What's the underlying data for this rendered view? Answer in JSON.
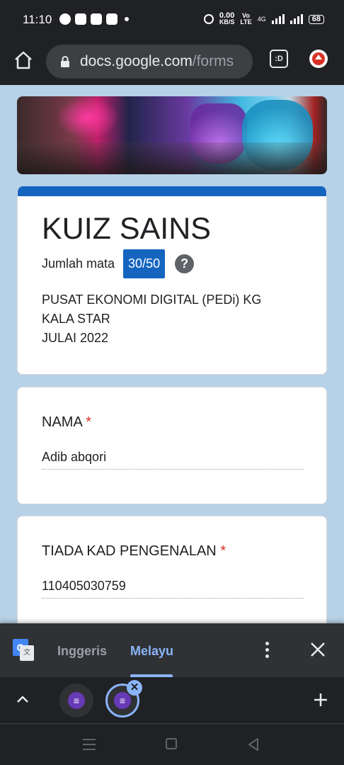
{
  "status_bar": {
    "time": "11:10",
    "net_speed_value": "0.00",
    "net_speed_unit": "KB/S",
    "volte_top": "Vo",
    "volte_bottom": "LTE",
    "network": "4G",
    "battery": "68"
  },
  "browser": {
    "url_host": "docs.google.com",
    "url_path": "/forms",
    "tab_switcher_label": ":D"
  },
  "form": {
    "title": "KUIZ SAINS",
    "score_label": "Jumlah mata",
    "score_value": "30/50",
    "help_glyph": "?",
    "description_lines": [
      "PUSAT EKONOMI DIGITAL (PEDi) KG",
      "KALA STAR",
      "JULAI 2022"
    ],
    "questions": [
      {
        "label": "NAMA",
        "required_mark": "*",
        "answer": "Adib abqori"
      },
      {
        "label": "TIADA KAD PENGENALAN",
        "required_mark": "*",
        "answer": "110405030759"
      }
    ],
    "accent_color": "#1565c0"
  },
  "translate_bar": {
    "logo_letter": "G",
    "source_language": "Inggeris",
    "target_language": "Melayu",
    "active_color": "#8ab4f8"
  },
  "tab_strip": {
    "close_glyph": "✕"
  },
  "icons": [
    "home-icon",
    "lock-icon",
    "update-icon",
    "google-translate-icon",
    "more-vert-icon",
    "close-icon",
    "chevron-up-icon",
    "forms-tab-icon",
    "plus-icon",
    "recents-icon",
    "home-nav-icon",
    "back-icon"
  ]
}
